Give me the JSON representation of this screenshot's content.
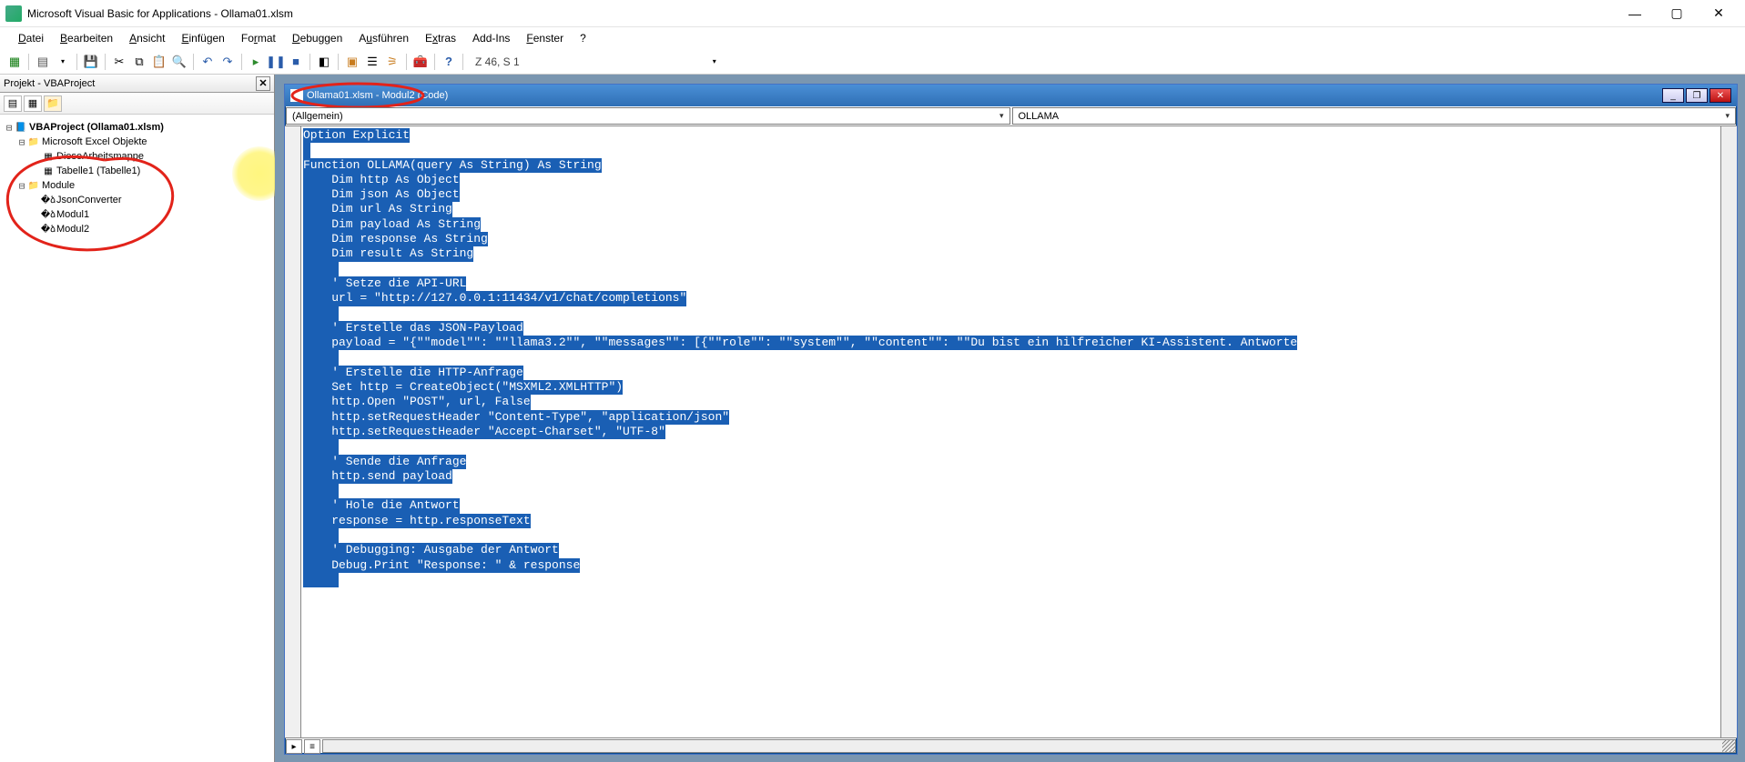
{
  "titlebar": {
    "text": "Microsoft Visual Basic for Applications - Ollama01.xlsm"
  },
  "menubar": {
    "items": [
      {
        "label": "Datei",
        "u": 0
      },
      {
        "label": "Bearbeiten",
        "u": 0
      },
      {
        "label": "Ansicht",
        "u": 0
      },
      {
        "label": "Einfügen",
        "u": 0
      },
      {
        "label": "Format",
        "u": 2
      },
      {
        "label": "Debuggen",
        "u": 0
      },
      {
        "label": "Ausführen",
        "u": 1
      },
      {
        "label": "Extras",
        "u": 1
      },
      {
        "label": "Add-Ins",
        "u": null
      },
      {
        "label": "Fenster",
        "u": 0
      },
      {
        "label": "?",
        "u": null
      }
    ]
  },
  "toolbar": {
    "cursor_pos": "Z 46, S 1"
  },
  "project_pane": {
    "title": "Projekt - VBAProject",
    "root": "VBAProject (Ollama01.xlsm)",
    "folder_excel": "Microsoft Excel Objekte",
    "excel_items": [
      "DieseArbeitsmappe",
      "Tabelle1 (Tabelle1)"
    ],
    "folder_module": "Module",
    "module_items": [
      "JsonConverter",
      "Modul1",
      "Modul2"
    ]
  },
  "code_window": {
    "title": "Ollama01.xlsm - Modul2 (Code)",
    "dropdown_left": "(Allgemein)",
    "dropdown_right": "OLLAMA"
  },
  "code_lines": [
    {
      "indent": 0,
      "text": "Option Explicit"
    },
    {
      "indent": 0,
      "text": ""
    },
    {
      "indent": 0,
      "text": "Function OLLAMA(query As String) As String"
    },
    {
      "indent": 1,
      "text": "Dim http As Object"
    },
    {
      "indent": 1,
      "text": "Dim json As Object"
    },
    {
      "indent": 1,
      "text": "Dim url As String"
    },
    {
      "indent": 1,
      "text": "Dim payload As String"
    },
    {
      "indent": 1,
      "text": "Dim response As String"
    },
    {
      "indent": 1,
      "text": "Dim result As String"
    },
    {
      "indent": 1,
      "text": ""
    },
    {
      "indent": 1,
      "text": "' Setze die API-URL"
    },
    {
      "indent": 1,
      "text": "url = \"http://127.0.0.1:11434/v1/chat/completions\""
    },
    {
      "indent": 1,
      "text": ""
    },
    {
      "indent": 1,
      "text": "' Erstelle das JSON-Payload"
    },
    {
      "indent": 1,
      "text": "payload = \"{\"\"model\"\": \"\"llama3.2\"\", \"\"messages\"\": [{\"\"role\"\": \"\"system\"\", \"\"content\"\": \"\"Du bist ein hilfreicher KI-Assistent. Antworte"
    },
    {
      "indent": 1,
      "text": ""
    },
    {
      "indent": 1,
      "text": "' Erstelle die HTTP-Anfrage"
    },
    {
      "indent": 1,
      "text": "Set http = CreateObject(\"MSXML2.XMLHTTP\")"
    },
    {
      "indent": 1,
      "text": "http.Open \"POST\", url, False"
    },
    {
      "indent": 1,
      "text": "http.setRequestHeader \"Content-Type\", \"application/json\""
    },
    {
      "indent": 1,
      "text": "http.setRequestHeader \"Accept-Charset\", \"UTF-8\""
    },
    {
      "indent": 1,
      "text": ""
    },
    {
      "indent": 1,
      "text": "' Sende die Anfrage"
    },
    {
      "indent": 1,
      "text": "http.send payload"
    },
    {
      "indent": 1,
      "text": ""
    },
    {
      "indent": 1,
      "text": "' Hole die Antwort"
    },
    {
      "indent": 1,
      "text": "response = http.responseText"
    },
    {
      "indent": 1,
      "text": ""
    },
    {
      "indent": 1,
      "text": "' Debugging: Ausgabe der Antwort"
    },
    {
      "indent": 1,
      "text": "Debug.Print \"Response: \" & response"
    },
    {
      "indent": 1,
      "text": ""
    }
  ]
}
